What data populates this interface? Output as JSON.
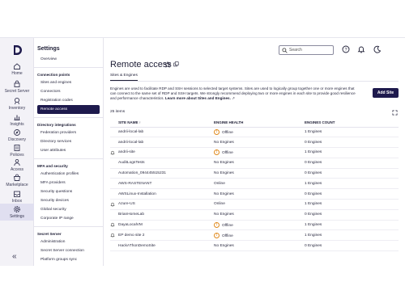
{
  "colors": {
    "accent": "#1e1a4d",
    "warning": "#e08a1e"
  },
  "rail": {
    "items": [
      {
        "label": "Home",
        "icon": "home-icon"
      },
      {
        "label": "Secret Server",
        "icon": "secret-server-icon"
      },
      {
        "label": "Inventory",
        "icon": "inventory-icon"
      },
      {
        "label": "Insights",
        "icon": "insights-icon"
      },
      {
        "label": "Discovery",
        "icon": "discovery-icon"
      },
      {
        "label": "Policies",
        "icon": "policies-icon"
      },
      {
        "label": "Access",
        "icon": "access-icon"
      },
      {
        "label": "Marketplace",
        "icon": "marketplace-icon"
      },
      {
        "label": "Inbox",
        "icon": "inbox-icon"
      },
      {
        "label": "Settings",
        "icon": "settings-icon"
      }
    ],
    "collapse": "«"
  },
  "nav": {
    "title": "Settings",
    "overview": "Overview",
    "groups": [
      {
        "title": "Connection points",
        "items": [
          "Sites and engines",
          "Connectors",
          "Registration codes",
          "Remote access"
        ]
      },
      {
        "title": "Directory integrations",
        "items": [
          "Federation providers",
          "Directory services",
          "User attributes"
        ]
      },
      {
        "title": "MFA and security",
        "items": [
          "Authentication profiles",
          "MFA providers",
          "Security questions",
          "Security devices",
          "Global security",
          "Corporate IP range"
        ]
      },
      {
        "title": "Secret Server",
        "items": [
          "Administration",
          "Secret Server connection",
          "Platform groups sync"
        ]
      },
      {
        "title": "General settings",
        "items": []
      }
    ]
  },
  "topbar": {
    "search_placeholder": "Search"
  },
  "page": {
    "title": "Remote access",
    "tab": "Sites & Engines",
    "description": "Engines are used to facilitate RDP and SSH sessions to selected target systems. Sites are used to logically group together one or more engines that can connect to the same set of RDP and SSH targets. We strongly recommend deploying two or more engines in each site to provide good resilience and performance characteristics.",
    "learn_more": "Learn more about Sites and Engines.",
    "add_button": "Add Site",
    "count": "25 items"
  },
  "table": {
    "headers": [
      "SITE NAME",
      "ENGINE HEALTH",
      "ENGINES COUNT"
    ],
    "sort_indicator": "↑",
    "rows": [
      {
        "bell": false,
        "name": "andrii-local-lab",
        "warn": true,
        "health": "Offline",
        "count": "1 Engines"
      },
      {
        "bell": false,
        "name": "andrii-local-lab",
        "warn": false,
        "health": "No Engines",
        "count": "0 Engines"
      },
      {
        "bell": true,
        "name": "andrii-site",
        "warn": true,
        "health": "Offline",
        "count": "1 Engines"
      },
      {
        "bell": false,
        "name": "AuditLogsTests",
        "warn": false,
        "health": "No Engines",
        "count": "0 Engines"
      },
      {
        "bell": false,
        "name": "Automation_094445515231",
        "warn": false,
        "health": "No Engines",
        "count": "0 Engines"
      },
      {
        "bell": false,
        "name": "AWS-RASTENANT",
        "warn": false,
        "health": "Online",
        "count": "1 Engines"
      },
      {
        "bell": false,
        "name": "AWSLinux-Installation",
        "warn": false,
        "health": "No Engines",
        "count": "0 Engines"
      },
      {
        "bell": true,
        "name": "Azure-US",
        "warn": false,
        "health": "Online",
        "count": "1 Engines"
      },
      {
        "bell": false,
        "name": "BrianHomeLab",
        "warn": false,
        "health": "No Engines",
        "count": "0 Engines"
      },
      {
        "bell": true,
        "name": "DayaLocalVM",
        "warn": true,
        "health": "Offline",
        "count": "1 Engines"
      },
      {
        "bell": true,
        "name": "EP demo site 2",
        "warn": true,
        "health": "Offline",
        "count": "1 Engines"
      },
      {
        "bell": false,
        "name": "HackAThonDemoSite",
        "warn": false,
        "health": "No Engines",
        "count": "0 Engines"
      }
    ]
  }
}
